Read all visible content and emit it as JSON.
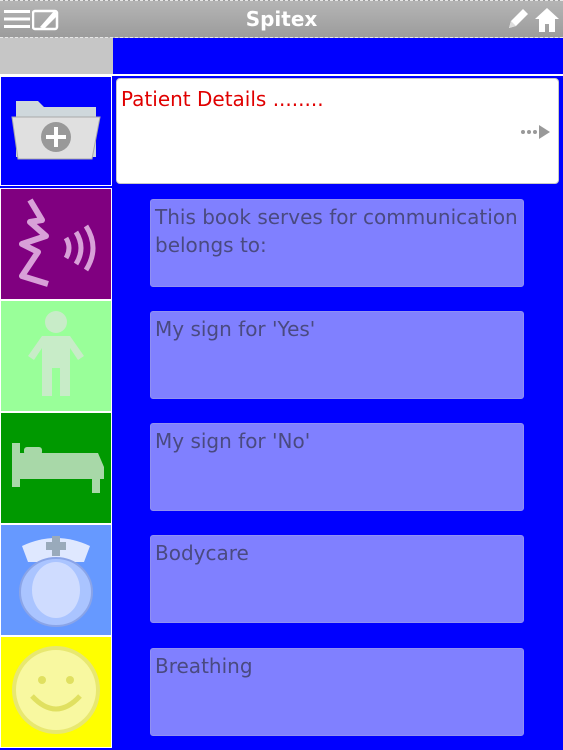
{
  "header": {
    "title": "Spitex"
  },
  "details": {
    "label": "Patient Details ........"
  },
  "cards": [
    "This book serves for communication\nbelongs to:",
    "My sign for 'Yes'",
    "My sign for 'No'",
    "Bodycare",
    "Breathing"
  ],
  "tiles": {
    "folder": {
      "bg": "#0000ff",
      "icon": "folder-plus-icon"
    },
    "speech": {
      "bg": "#800080",
      "icon": "speaking-head-icon"
    },
    "person": {
      "bg": "#99ff99",
      "icon": "person-icon"
    },
    "bed": {
      "bg": "#009900",
      "icon": "bed-icon"
    },
    "nurse": {
      "bg": "#6699ff",
      "icon": "nurse-icon"
    },
    "smile": {
      "bg": "#ffff00",
      "icon": "smiley-icon"
    }
  },
  "colors": {
    "background": "#0000ff",
    "card": "#8080ff",
    "details_text": "#e00000",
    "card_text": "#4a4a80"
  }
}
